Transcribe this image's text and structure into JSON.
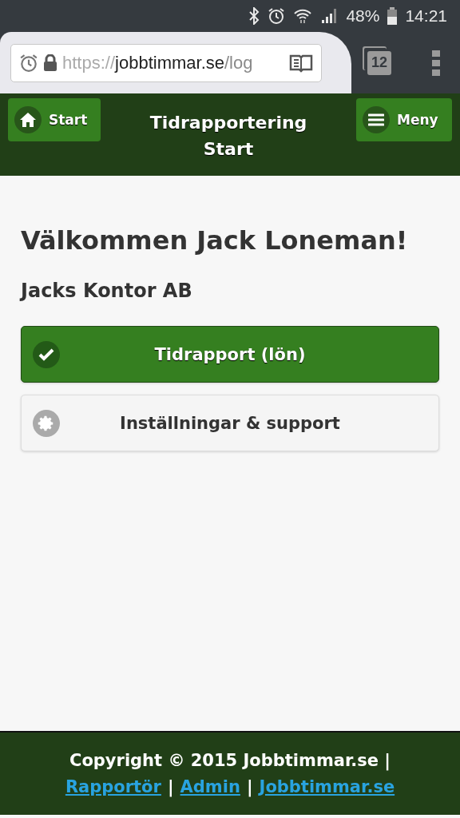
{
  "status_bar": {
    "battery": "48%",
    "time": "14:21"
  },
  "browser": {
    "url": {
      "scheme": "https://",
      "host": "jobbtimmar.se",
      "path": "/log"
    },
    "tab_count": "12"
  },
  "header": {
    "left_button": "Start",
    "title": [
      "Tidrapportering",
      "Start"
    ],
    "right_button": "Meny"
  },
  "welcome": "Välkommen Jack Loneman!",
  "company": "Jacks Kontor AB",
  "actions": [
    {
      "kind": "primary",
      "label": "Tidrapport (lön)"
    },
    {
      "kind": "default",
      "label": "Inställningar & support"
    }
  ],
  "footer": {
    "copyright": "Copyright © 2015 Jobbtimmar.se |",
    "items": [
      {
        "kind": "link",
        "text": "Rapportör"
      },
      {
        "kind": "separator",
        "text": "|"
      },
      {
        "kind": "link",
        "text": "Admin"
      },
      {
        "kind": "separator",
        "text": "|"
      },
      {
        "kind": "link",
        "text": "Jobbtimmar.se"
      }
    ]
  }
}
